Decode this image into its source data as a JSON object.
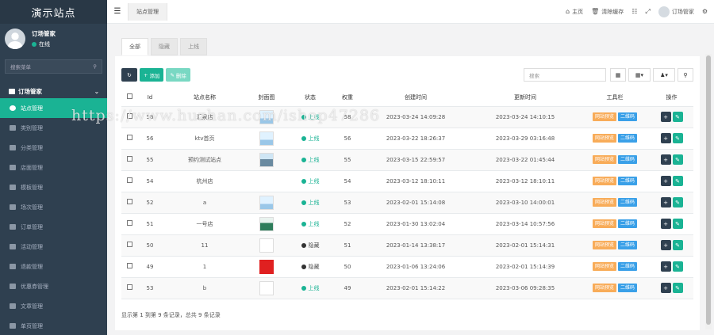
{
  "sidebar": {
    "brand": "演示站点",
    "user": {
      "name": "订场管家",
      "status": "在线"
    },
    "search_placeholder": "搜索菜单",
    "group_title": "订场管家",
    "items": [
      {
        "label": "站点管理",
        "active": true
      },
      {
        "label": "类别管理"
      },
      {
        "label": "分类管理"
      },
      {
        "label": "店面管理"
      },
      {
        "label": "模板管理"
      },
      {
        "label": "场次管理"
      },
      {
        "label": "订单管理"
      },
      {
        "label": "活动管理"
      },
      {
        "label": "退款管理"
      },
      {
        "label": "优惠券管理"
      },
      {
        "label": "文章管理"
      },
      {
        "label": "单页管理"
      }
    ]
  },
  "topbar": {
    "page_tab": "站点管理",
    "home": "主页",
    "clear_cache": "清除缓存",
    "user": "订场管家"
  },
  "content": {
    "tabs": [
      "全部",
      "隐藏",
      "上线"
    ],
    "toolbar": {
      "add": "添加",
      "delete": "删除"
    },
    "search_placeholder": "搜索",
    "columns": [
      "Id",
      "站点名称",
      "封面图",
      "状态",
      "权重",
      "创建时间",
      "更新时间",
      "工具栏",
      "操作"
    ],
    "tag_labels": {
      "site_preview": "网站预览",
      "qrcode": "二维码"
    },
    "rows": [
      {
        "id": "58",
        "name": "汇泉店",
        "img": "banner",
        "status": "上线",
        "status_type": "on",
        "weight": "58",
        "created": "2023-03-24 14:09:28",
        "updated": "2023-03-24 14:10:15"
      },
      {
        "id": "56",
        "name": "ktv首页",
        "img": "banner",
        "status": "上线",
        "status_type": "on",
        "weight": "56",
        "created": "2023-03-22 18:26:37",
        "updated": "2023-03-29 03:16:48"
      },
      {
        "id": "55",
        "name": "预约测试站点",
        "img": "scene",
        "status": "上线",
        "status_type": "on",
        "weight": "55",
        "created": "2023-03-15 22:59:57",
        "updated": "2023-03-22 01:45:44"
      },
      {
        "id": "54",
        "name": "杭州店",
        "img": "",
        "status": "上线",
        "status_type": "on",
        "weight": "54",
        "created": "2023-03-12 18:10:11",
        "updated": "2023-03-12 18:10:11"
      },
      {
        "id": "52",
        "name": "a",
        "img": "banner",
        "status": "上线",
        "status_type": "on",
        "weight": "53",
        "created": "2023-02-01 15:14:08",
        "updated": "2023-03-10 14:00:01"
      },
      {
        "id": "51",
        "name": "一号店",
        "img": "hotel",
        "status": "上线",
        "status_type": "on",
        "weight": "52",
        "created": "2023-01-30 13:02:04",
        "updated": "2023-03-14 10:57:56"
      },
      {
        "id": "50",
        "name": "11",
        "img": "broken",
        "status": "隐藏",
        "status_type": "off",
        "weight": "51",
        "created": "2023-01-14 13:38:17",
        "updated": "2023-02-01 15:14:31"
      },
      {
        "id": "49",
        "name": "1",
        "img": "red",
        "status": "隐藏",
        "status_type": "off",
        "weight": "50",
        "created": "2023-01-06 13:24:06",
        "updated": "2023-02-01 15:14:39"
      },
      {
        "id": "53",
        "name": "b",
        "img": "broken",
        "status": "上线",
        "status_type": "on",
        "weight": "49",
        "created": "2023-02-01 15:14:22",
        "updated": "2023-03-06 09:28:35"
      }
    ],
    "pagination_text": "显示第 1 到第 9 条记录，总共 9 条记录"
  },
  "watermark": "https://www.huzhan.com/ishop47286",
  "colors": {
    "sidebar_bg": "#2f4050",
    "accent": "#1ab394",
    "tag_orange": "#f8ac59",
    "tag_blue": "#3aa0e8"
  }
}
